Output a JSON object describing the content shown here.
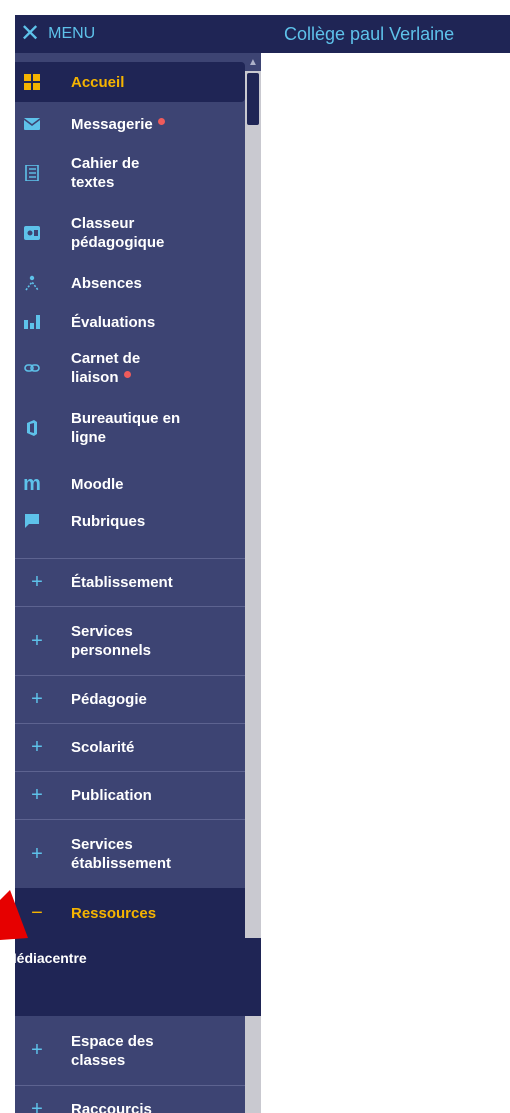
{
  "header": {
    "menu_label": "MENU",
    "site_title": "Collège paul Verlaine"
  },
  "nav": {
    "items": [
      {
        "label": "Accueil",
        "icon": "grid-icon"
      },
      {
        "label": "Messagerie",
        "icon": "mail-icon"
      },
      {
        "label": "Cahier de\ntextes",
        "icon": "notebook-icon"
      },
      {
        "label": "Classeur\npédagogique",
        "icon": "binder-icon"
      },
      {
        "label": "Absences",
        "icon": "person-absent-icon"
      },
      {
        "label": "Évaluations",
        "icon": "bar-chart-icon"
      },
      {
        "label": "Carnet de\nliaison",
        "icon": "link-icon"
      },
      {
        "label": "Bureautique en\nligne",
        "icon": "office-icon"
      },
      {
        "label": "Moodle",
        "icon": "moodle-icon"
      },
      {
        "label": "Rubriques",
        "icon": "chat-icon"
      }
    ]
  },
  "sections": [
    {
      "label": "Établissement",
      "symbol": "+"
    },
    {
      "label": "Services\npersonnels",
      "symbol": "+"
    },
    {
      "label": "Pédagogie",
      "symbol": "+"
    },
    {
      "label": "Scolarité",
      "symbol": "+"
    },
    {
      "label": "Publication",
      "symbol": "+"
    },
    {
      "label": "Services\nétablissement",
      "symbol": "+"
    },
    {
      "label": "Ressources",
      "symbol": "−"
    },
    {
      "label": "Espace des\nclasses",
      "symbol": "+"
    },
    {
      "label": "Raccourcis",
      "symbol": "+"
    }
  ],
  "submenu": {
    "item": "Médiacentre"
  },
  "colors": {
    "sidebar": "#3d4473",
    "header": "#1f2555",
    "accent": "#5ec2ea",
    "active": "#f5b400",
    "badge": "#ef5b5b",
    "pointer": "#e60000"
  }
}
